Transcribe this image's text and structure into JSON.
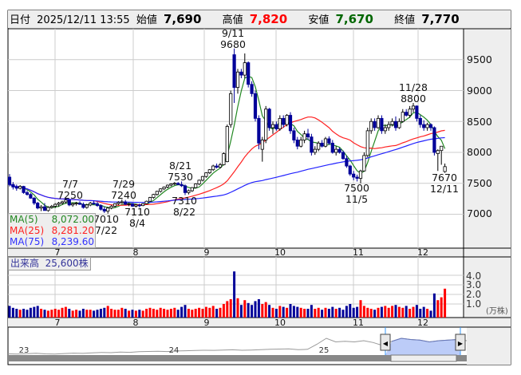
{
  "header": {
    "date_label": "日付",
    "date": "2025/12/11 13:55",
    "open_label": "始値",
    "open": "7,690",
    "high_label": "高値",
    "high": "7,820",
    "low_label": "安値",
    "low": "7,670",
    "close_label": "終値",
    "close": "7,770"
  },
  "colors": {
    "up_fill": "#ffffff",
    "down_fill": "#000099",
    "ma5": "#228822",
    "ma25": "#ff2222",
    "ma75": "#2222ff",
    "high_text": "#ff0000",
    "low_text": "#006600",
    "vol_up": "#ff0000",
    "vol_down": "#000099",
    "vol_flat": "#999999"
  },
  "legend": [
    {
      "name": "MA(5)",
      "value": "8,072.00"
    },
    {
      "name": "MA(25)",
      "value": "8,281.20"
    },
    {
      "name": "MA(75)",
      "value": "8,239.60"
    }
  ],
  "volume_title": {
    "label": "出来高",
    "value": "25,600株"
  },
  "volume_axis": {
    "ticks": [
      "4.0",
      "3.0",
      "2.0",
      "1.0"
    ],
    "unit": "(万株)"
  },
  "navigator": {
    "labels": [
      "23",
      "24",
      "25"
    ]
  },
  "chart_data": {
    "type": "candlestick",
    "price_axis": {
      "ticks": [
        "9500",
        "9000",
        "8500",
        "8000",
        "7500",
        "7000"
      ],
      "range": [
        6500,
        10000
      ]
    },
    "months": [
      "7",
      "8",
      "9",
      "10",
      "11",
      "12"
    ],
    "annotations": [
      {
        "date": "9/11",
        "price": "9680"
      },
      {
        "date": "11/28",
        "price": "8800"
      },
      {
        "date": "7/7",
        "price": "7250"
      },
      {
        "date": "7/29",
        "price": "7240"
      },
      {
        "date": "8/21",
        "price": "7530"
      },
      {
        "date": "7310",
        "price": "8/22"
      },
      {
        "date": "7110",
        "price": "8/4"
      },
      {
        "date": "7010",
        "price": "7/22"
      },
      {
        "date": "7500",
        "price": "11/5"
      },
      {
        "date": "7670",
        "price": "12/11"
      }
    ],
    "ohlc": [
      [
        7600,
        7650,
        7450,
        7480
      ],
      [
        7480,
        7520,
        7400,
        7440
      ],
      [
        7440,
        7480,
        7380,
        7420
      ],
      [
        7420,
        7470,
        7400,
        7450
      ],
      [
        7450,
        7460,
        7330,
        7350
      ],
      [
        7350,
        7380,
        7300,
        7320
      ],
      [
        7320,
        7340,
        7250,
        7260
      ],
      [
        7260,
        7280,
        7150,
        7180
      ],
      [
        7180,
        7200,
        7080,
        7100
      ],
      [
        7100,
        7150,
        7050,
        7120
      ],
      [
        7120,
        7180,
        7060,
        7060
      ],
      [
        7060,
        7130,
        7040,
        7110
      ],
      [
        7110,
        7150,
        7090,
        7130
      ],
      [
        7130,
        7180,
        7100,
        7160
      ],
      [
        7160,
        7200,
        7120,
        7180
      ],
      [
        7180,
        7220,
        7150,
        7200
      ],
      [
        7200,
        7250,
        7170,
        7230
      ],
      [
        7230,
        7240,
        7130,
        7150
      ],
      [
        7150,
        7190,
        7120,
        7170
      ],
      [
        7170,
        7200,
        7140,
        7180
      ],
      [
        7180,
        7210,
        7150,
        7160
      ],
      [
        7160,
        7190,
        7090,
        7110
      ],
      [
        7110,
        7170,
        7090,
        7150
      ],
      [
        7150,
        7200,
        7130,
        7180
      ],
      [
        7180,
        7220,
        7150,
        7170
      ],
      [
        7170,
        7200,
        7120,
        7140
      ],
      [
        7140,
        7160,
        7060,
        7080
      ],
      [
        7080,
        7120,
        7020,
        7050
      ],
      [
        7050,
        7120,
        7010,
        7100
      ],
      [
        7100,
        7150,
        7080,
        7130
      ],
      [
        7130,
        7180,
        7110,
        7170
      ],
      [
        7170,
        7210,
        7150,
        7190
      ],
      [
        7190,
        7240,
        7170,
        7200
      ],
      [
        7200,
        7230,
        7150,
        7160
      ],
      [
        7160,
        7190,
        7130,
        7170
      ],
      [
        7170,
        7180,
        7120,
        7130
      ],
      [
        7130,
        7160,
        7110,
        7150
      ],
      [
        7150,
        7170,
        7110,
        7140
      ],
      [
        7140,
        7180,
        7130,
        7170
      ],
      [
        7170,
        7220,
        7160,
        7210
      ],
      [
        7210,
        7280,
        7200,
        7270
      ],
      [
        7270,
        7330,
        7250,
        7320
      ],
      [
        7320,
        7380,
        7300,
        7370
      ],
      [
        7370,
        7420,
        7350,
        7410
      ],
      [
        7410,
        7450,
        7390,
        7440
      ],
      [
        7440,
        7480,
        7420,
        7470
      ],
      [
        7470,
        7500,
        7450,
        7490
      ],
      [
        7490,
        7520,
        7470,
        7500
      ],
      [
        7500,
        7520,
        7470,
        7480
      ],
      [
        7480,
        7530,
        7440,
        7460
      ],
      [
        7460,
        7480,
        7310,
        7350
      ],
      [
        7350,
        7400,
        7320,
        7380
      ],
      [
        7380,
        7440,
        7360,
        7430
      ],
      [
        7430,
        7500,
        7420,
        7490
      ],
      [
        7490,
        7560,
        7470,
        7550
      ],
      [
        7550,
        7620,
        7530,
        7610
      ],
      [
        7610,
        7680,
        7590,
        7670
      ],
      [
        7670,
        7730,
        7650,
        7720
      ],
      [
        7720,
        7800,
        7700,
        7780
      ],
      [
        7780,
        7820,
        7740,
        7760
      ],
      [
        7760,
        7830,
        7740,
        7800
      ],
      [
        7800,
        8000,
        7790,
        7980
      ],
      [
        7850,
        8450,
        7840,
        8420
      ],
      [
        8450,
        9000,
        8400,
        8950
      ],
      [
        9580,
        9680,
        8800,
        9050
      ],
      [
        9050,
        9350,
        8950,
        9300
      ],
      [
        9300,
        9350,
        9200,
        9250
      ],
      [
        9250,
        9600,
        9200,
        9450
      ],
      [
        9450,
        9470,
        9050,
        9100
      ],
      [
        9100,
        9150,
        8900,
        8950
      ],
      [
        8950,
        9000,
        8500,
        8550
      ],
      [
        8550,
        8600,
        8050,
        8150
      ],
      [
        8050,
        8250,
        7850,
        8200
      ],
      [
        8200,
        8750,
        8150,
        8700
      ],
      [
        8700,
        8720,
        8350,
        8400
      ],
      [
        8400,
        8500,
        8300,
        8450
      ],
      [
        8450,
        8500,
        8350,
        8380
      ],
      [
        8380,
        8600,
        8350,
        8550
      ],
      [
        8550,
        8600,
        8400,
        8450
      ],
      [
        8450,
        8620,
        8420,
        8600
      ],
      [
        8600,
        8650,
        8300,
        8350
      ],
      [
        8350,
        8400,
        8150,
        8200
      ],
      [
        8200,
        8250,
        8050,
        8100
      ],
      [
        8100,
        8250,
        8080,
        8200
      ],
      [
        8200,
        8350,
        8150,
        8300
      ],
      [
        8300,
        8380,
        8200,
        8250
      ],
      [
        8250,
        8300,
        7950,
        8000
      ],
      [
        8000,
        8100,
        7960,
        8050
      ],
      [
        8050,
        8180,
        8020,
        8150
      ],
      [
        8150,
        8200,
        8080,
        8100
      ],
      [
        8100,
        8250,
        8080,
        8220
      ],
      [
        8220,
        8260,
        8120,
        8150
      ],
      [
        8150,
        8200,
        7980,
        8000
      ],
      [
        8000,
        8100,
        7950,
        8050
      ],
      [
        8050,
        8080,
        7980,
        8000
      ],
      [
        8000,
        8030,
        7880,
        7900
      ],
      [
        7900,
        7950,
        7750,
        7780
      ],
      [
        7780,
        7800,
        7620,
        7650
      ],
      [
        7650,
        7700,
        7550,
        7600
      ],
      [
        7600,
        7640,
        7530,
        7580
      ],
      [
        7580,
        7720,
        7500,
        7700
      ],
      [
        7700,
        8000,
        7690,
        7950
      ],
      [
        7950,
        8400,
        7920,
        8350
      ],
      [
        8350,
        8550,
        8300,
        8500
      ],
      [
        8500,
        8550,
        8350,
        8400
      ],
      [
        8400,
        8600,
        8380,
        8550
      ],
      [
        8550,
        8600,
        8300,
        8350
      ],
      [
        8350,
        8450,
        8300,
        8400
      ],
      [
        8400,
        8500,
        8350,
        8450
      ],
      [
        8450,
        8550,
        8420,
        8500
      ],
      [
        8500,
        8580,
        8350,
        8400
      ],
      [
        8400,
        8550,
        8380,
        8500
      ],
      [
        8500,
        8700,
        8480,
        8650
      ],
      [
        8650,
        8700,
        8580,
        8600
      ],
      [
        8600,
        8750,
        8560,
        8700
      ],
      [
        8700,
        8800,
        8650,
        8750
      ],
      [
        8750,
        8760,
        8500,
        8550
      ],
      [
        8550,
        8600,
        8400,
        8450
      ],
      [
        8450,
        8520,
        8350,
        8400
      ],
      [
        8400,
        8480,
        8350,
        8450
      ],
      [
        8450,
        8470,
        8350,
        8400
      ],
      [
        8400,
        8420,
        7950,
        8000
      ],
      [
        7980,
        8050,
        7700,
        8030
      ],
      [
        8030,
        8100,
        7800,
        8100
      ],
      [
        7690,
        7820,
        7670,
        7770
      ]
    ],
    "volume_10k": [
      0.8,
      0.6,
      0.5,
      0.4,
      0.5,
      0.4,
      0.6,
      0.7,
      0.8,
      0.5,
      0.4,
      0.3,
      0.4,
      0.5,
      0.4,
      0.6,
      0.7,
      0.5,
      0.3,
      0.4,
      0.3,
      0.5,
      0.4,
      0.4,
      0.3,
      0.4,
      0.5,
      0.6,
      0.8,
      0.5,
      0.4,
      0.4,
      0.6,
      0.5,
      0.3,
      0.4,
      0.3,
      0.4,
      0.3,
      0.5,
      0.6,
      0.5,
      0.4,
      0.6,
      0.5,
      0.4,
      0.5,
      0.6,
      0.4,
      0.7,
      0.9,
      0.5,
      0.4,
      0.5,
      0.6,
      0.5,
      0.7,
      0.6,
      0.8,
      0.5,
      0.6,
      1.0,
      1.3,
      1.5,
      4.4,
      1.6,
      0.9,
      1.4,
      1.1,
      0.9,
      1.3,
      1.5,
      1.0,
      1.2,
      0.9,
      0.6,
      0.5,
      0.8,
      0.7,
      0.6,
      1.0,
      0.8,
      0.7,
      0.6,
      0.5,
      0.5,
      0.9,
      0.5,
      0.6,
      0.4,
      0.6,
      0.5,
      0.7,
      0.5,
      0.6,
      0.4,
      0.8,
      1.0,
      0.6,
      0.7,
      1.4,
      0.8,
      0.6,
      0.5,
      0.4,
      0.6,
      0.7,
      0.8,
      0.6,
      0.8,
      0.9,
      0.7,
      0.6,
      0.8,
      0.5,
      0.7,
      0.9,
      0.5,
      0.7,
      0.5,
      0.3,
      2.1,
      1.4,
      1.7,
      2.6
    ],
    "navigator_series": [
      7300,
      7280,
      7320,
      7350,
      7300,
      7280,
      7330,
      7360,
      7340,
      7380,
      7420,
      7400,
      7450,
      7430,
      7480,
      7500,
      7520,
      7490,
      7540,
      7560,
      7580,
      7600,
      7590,
      7620,
      7640,
      7600,
      7620,
      7650,
      7680,
      7700,
      7720,
      7650,
      7680,
      8100,
      8600,
      8300,
      8350,
      8300,
      8400,
      8250,
      8000,
      8350,
      8600,
      8500,
      8450,
      8300,
      8400,
      8450,
      8500,
      8400
    ]
  }
}
